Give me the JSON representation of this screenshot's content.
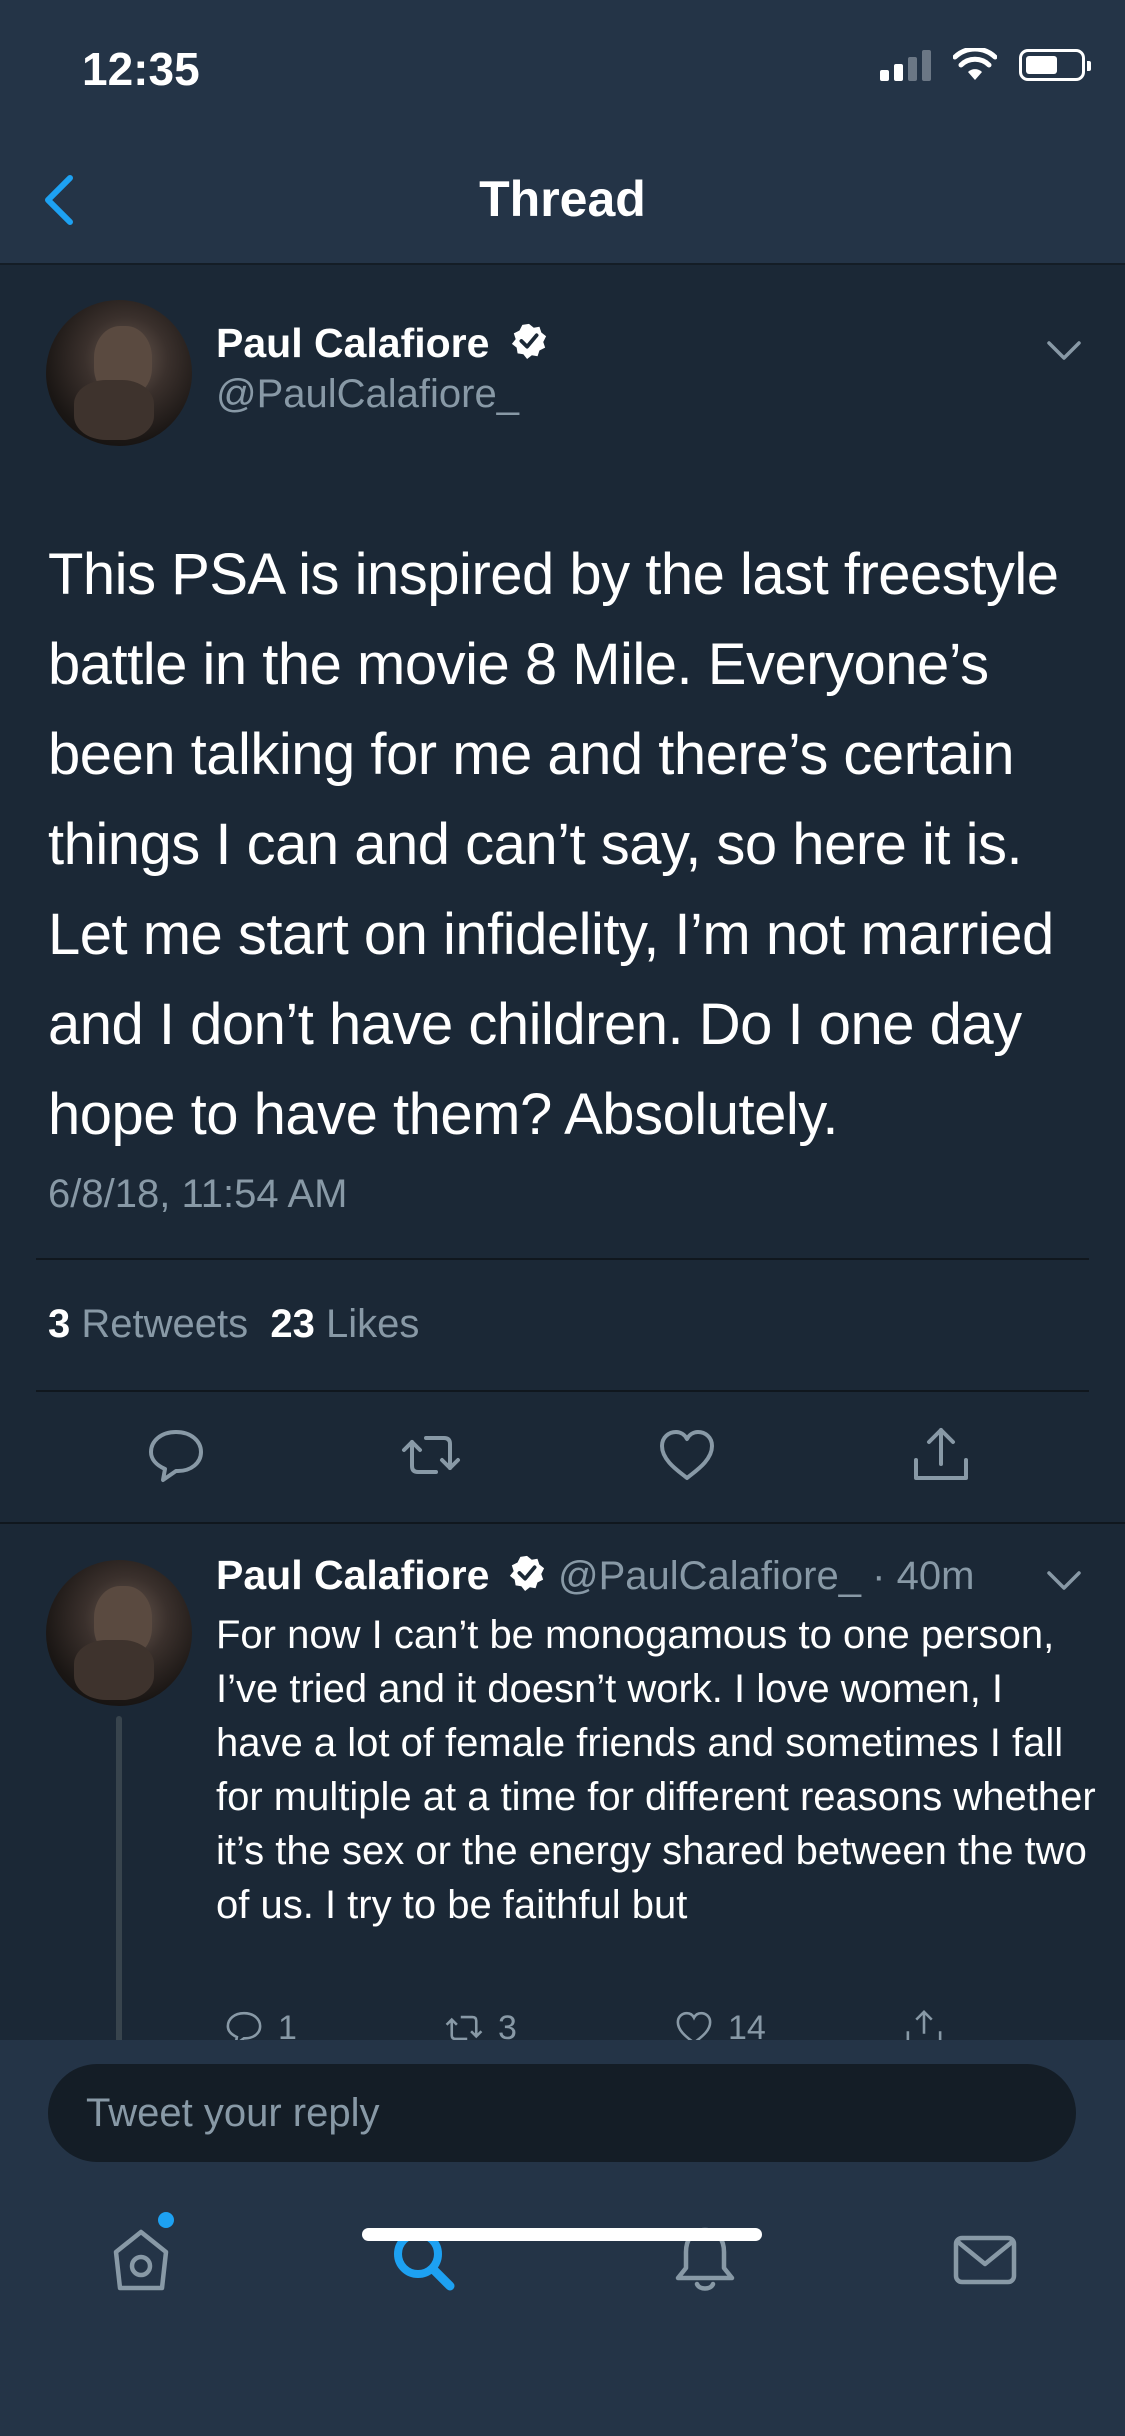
{
  "status_bar": {
    "time": "12:35"
  },
  "nav": {
    "title": "Thread"
  },
  "main_tweet": {
    "author_name": "Paul Calafiore",
    "handle": "@PaulCalafiore_",
    "text": "This PSA is inspired by the last freestyle battle in the movie 8 Mile. Everyone’s been talking for me and there’s certain things I can and can’t say, so here it is. Let me start on infidelity, I’m not married and I don’t have children. Do I one day hope to have them? Absolutely.",
    "timestamp": "6/8/18, 11:54 AM",
    "retweets_count": "3",
    "retweets_label": "Retweets",
    "likes_count": "23",
    "likes_label": "Likes"
  },
  "reply_tweet": {
    "author_name": "Paul Calafiore",
    "handle": "@PaulCalafiore_",
    "separator": "·",
    "time": "40m",
    "text": "For now I can’t be monogamous to one person, I’ve tried and it doesn’t work. I love women, I have a lot of female friends and sometimes I fall for multiple at a time for different reasons whether it’s the sex or the energy shared between the two of us. I try to be faithful but",
    "reply_count": "1",
    "retweet_count": "3",
    "like_count": "14"
  },
  "composer": {
    "placeholder": "Tweet your reply"
  },
  "colors": {
    "accent": "#1da1f2",
    "background": "#1b2836",
    "bar": "#243447",
    "secondary_text": "#8899a6"
  },
  "icons": {
    "back": "chevron-left-icon",
    "verified": "verified-badge-icon",
    "more": "chevron-down-icon",
    "reply": "speech-bubble-icon",
    "retweet": "retweet-arrows-icon",
    "like": "heart-icon",
    "share": "share-icon",
    "home": "home-icon",
    "search": "search-icon",
    "notifications": "bell-icon",
    "messages": "envelope-icon"
  }
}
